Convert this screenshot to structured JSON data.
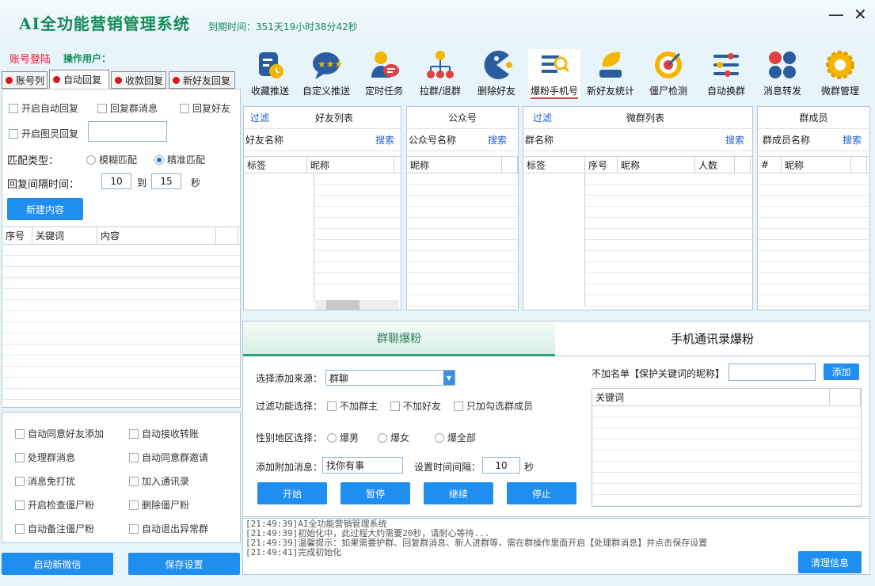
{
  "window": {
    "title": "AI全功能营销管理系统",
    "expire": "到期时间：351天19小时38分42秒"
  },
  "account": {
    "login": "账号登陆",
    "operator": "操作用户："
  },
  "left_tabs": [
    {
      "label": "账号列"
    },
    {
      "label": "自动回复"
    },
    {
      "label": "收款回复"
    },
    {
      "label": "新好友回复"
    }
  ],
  "auto_reply": {
    "enable_auto": "开启自动回复",
    "reply_group": "回复群消息",
    "reply_friend": "回复好友",
    "enable_img": "开启图灵回复",
    "match_type": "匹配类型：",
    "fuzzy": "模糊匹配",
    "exact": "精准匹配",
    "interval": "回复间隔时间：",
    "from": "10",
    "to_label": "到",
    "to": "15",
    "unit": "秒",
    "new_btn": "新建内容",
    "columns": [
      "序号",
      "关键词",
      "内容"
    ]
  },
  "options": [
    [
      "自动同意好友添加",
      "自动接收转账"
    ],
    [
      "处理群消息",
      "自动同意群邀请"
    ],
    [
      "消息免打扰",
      "加入通讯录"
    ],
    [
      "开启检查僵尸粉",
      "删除僵尸粉"
    ],
    [
      "自动备注僵尸粉",
      "自动退出异常群"
    ]
  ],
  "bottom_buttons": {
    "start_wechat": "启动新微信",
    "save": "保存设置"
  },
  "toolbar": [
    {
      "label": "收藏推送",
      "icon": "favorite-push-icon"
    },
    {
      "label": "自定义推送",
      "icon": "custom-push-icon"
    },
    {
      "label": "定时任务",
      "icon": "scheduled-task-icon"
    },
    {
      "label": "拉群/退群",
      "icon": "group-join-icon"
    },
    {
      "label": "删除好友",
      "icon": "delete-friend-icon"
    },
    {
      "label": "爆粉手机号",
      "icon": "phone-fans-icon"
    },
    {
      "label": "新好友统计",
      "icon": "new-friend-stats-icon"
    },
    {
      "label": "僵尸检测",
      "icon": "zombie-detect-icon"
    },
    {
      "label": "自动换群",
      "icon": "auto-switch-group-icon"
    },
    {
      "label": "消息转发",
      "icon": "message-forward-icon"
    },
    {
      "label": "微群管理",
      "icon": "group-manage-icon"
    }
  ],
  "panels": {
    "friends": {
      "filter": "过滤",
      "title": "好友列表",
      "name_label": "好友名称",
      "search": "搜索",
      "cols": [
        "标签",
        "昵称"
      ]
    },
    "official": {
      "title": "公众号",
      "name_label": "公众号名称",
      "search": "搜索",
      "cols": [
        "昵称"
      ]
    },
    "groups": {
      "filter": "过滤",
      "title": "微群列表",
      "name_label": "群名称",
      "search": "搜索",
      "cols": [
        "标签",
        "序号",
        "昵称",
        "人数"
      ]
    },
    "members": {
      "title": "群成员",
      "name_label": "群成员名称",
      "search": "搜索",
      "cols": [
        "#",
        "昵称"
      ]
    }
  },
  "fans": {
    "tab_group": "群聊爆粉",
    "tab_phone": "手机通讯录爆粉",
    "source_label": "选择添加来源：",
    "source_value": "群聊",
    "filter_label": "过滤功能选择：",
    "no_owner": "不加群主",
    "no_friend": "不加好友",
    "only_checked": "只加勾选群成员",
    "gender_label": "性别地区选择：",
    "male": "爆男",
    "female": "爆女",
    "all": "爆全部",
    "msg_label": "添加附加消息：",
    "msg_value": "找你有事",
    "interval_label": "设置时间间隔：",
    "interval_value": "10",
    "interval_unit": "秒",
    "exclude_label": "不加名单【保护关键词的昵称】",
    "add_btn": "添加",
    "keyword_col": "关键词",
    "start": "开始",
    "pause": "暂停",
    "resume": "继续",
    "stop": "停止"
  },
  "log": {
    "lines": [
      "[21:49:39]AI全功能营销管理系统",
      "[21:49:39]初始化中，此过程大约需要20秒，请耐心等待...",
      "[21:49:39]温馨提示：如果需要护群、回复群消息、新人进群等，需在群操作里面开启【处理群消息】并点击保存设置",
      "[21:49:41]完成初始化"
    ],
    "clear_btn": "清理信息"
  }
}
